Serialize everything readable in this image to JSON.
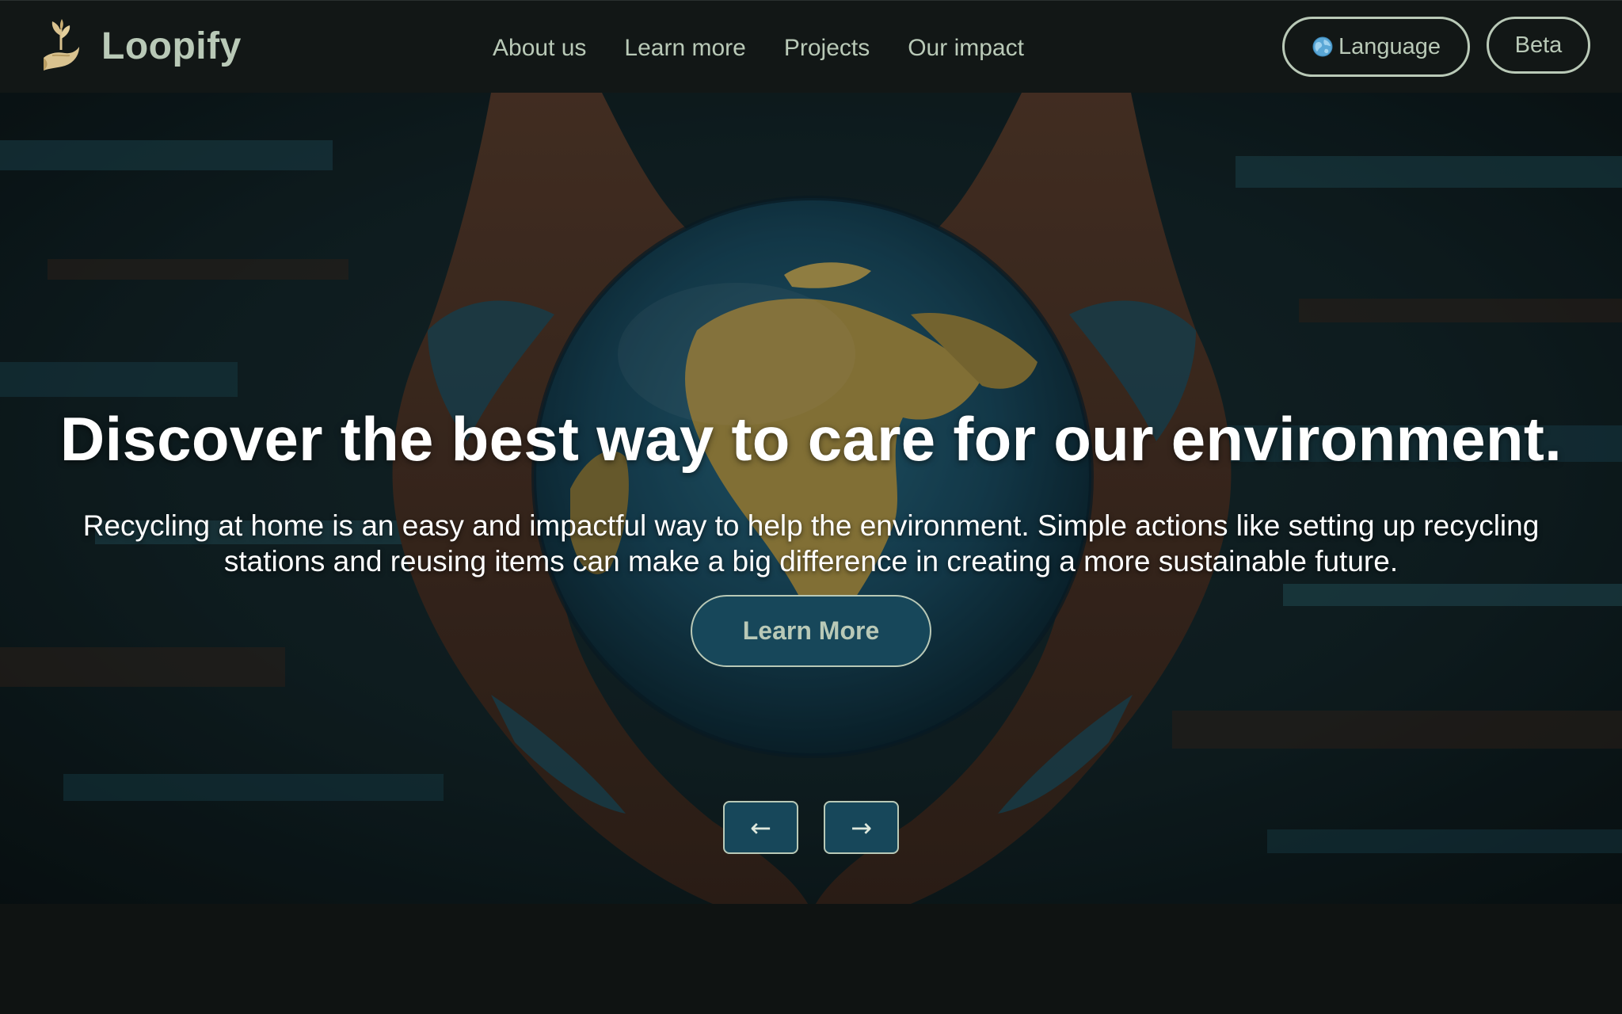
{
  "brand": {
    "name": "Loopify",
    "logo_icon": "hand-sprout-icon"
  },
  "nav": {
    "items": [
      {
        "label": "About us"
      },
      {
        "label": "Learn more"
      },
      {
        "label": "Projects"
      },
      {
        "label": "Our impact"
      }
    ]
  },
  "header_actions": {
    "language_label": "Language",
    "language_icon": "globe-icon",
    "beta_label": "Beta"
  },
  "hero": {
    "heading": "Discover the best way to care for our environment.",
    "subtext": "Recycling at home is an easy and impactful way to help the environment. Simple actions like setting up recycling stations and reusing items can make a big difference in creating a more sustainable future.",
    "cta_label": "Learn More",
    "prev_glyph": "←",
    "next_glyph": "→",
    "background": "hands-holding-earth-globe-image"
  },
  "colors": {
    "header_bg": "#121716",
    "page_bg": "#0f1312",
    "accent_text": "#b9c9b7",
    "button_fill": "#17475a",
    "hero_text": "#ffffff"
  }
}
